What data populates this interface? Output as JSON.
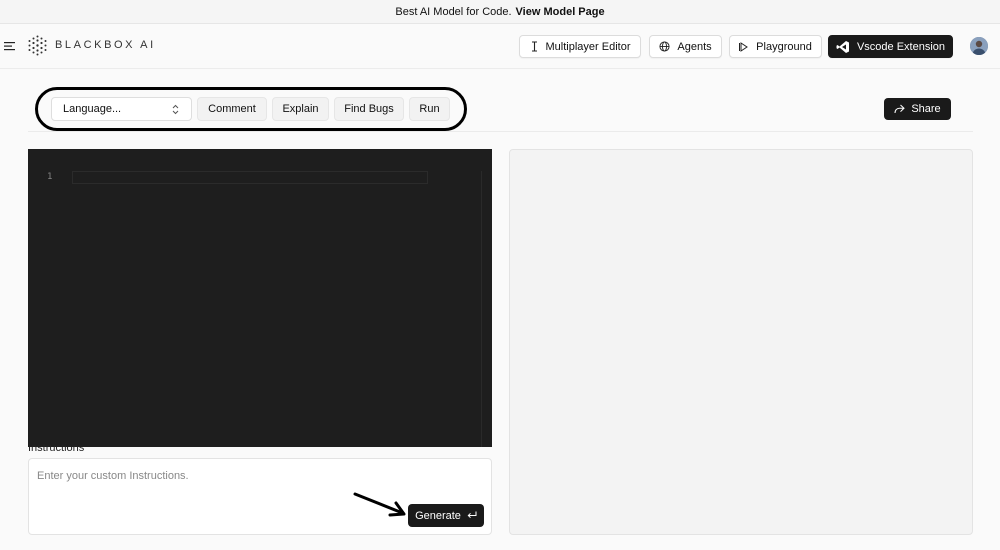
{
  "banner": {
    "text": "Best AI Model for Code.",
    "link": "View Model Page"
  },
  "brand": {
    "name": "BLACKBOX AI"
  },
  "nav": {
    "multiplayer": "Multiplayer Editor",
    "agents": "Agents",
    "playground": "Playground",
    "vscode": "Vscode Extension"
  },
  "toolbar": {
    "language_value": "Language...",
    "comment": "Comment",
    "explain": "Explain",
    "find_bugs": "Find Bugs",
    "run": "Run",
    "share": "Share"
  },
  "editor": {
    "line_number": "1"
  },
  "instructions": {
    "label": "Instructions",
    "placeholder": "Enter your custom Instructions.",
    "generate": "Generate"
  },
  "icons": {
    "menu": "menu-icon",
    "logo": "blackbox-logo-icon",
    "cursor": "text-cursor-icon",
    "globe": "globe-icon",
    "play": "play-icon",
    "vscode": "vscode-icon",
    "chevrons": "chevron-updown-icon",
    "share": "share-arrow-icon",
    "enter": "enter-return-icon",
    "annotation_arrow": "annotation-arrow-icon"
  },
  "colors": {
    "dark_button": "#1a1a1a",
    "editor_bg": "#1e1e1e",
    "page_bg": "#fafafa",
    "output_bg": "#f3f3f3"
  }
}
